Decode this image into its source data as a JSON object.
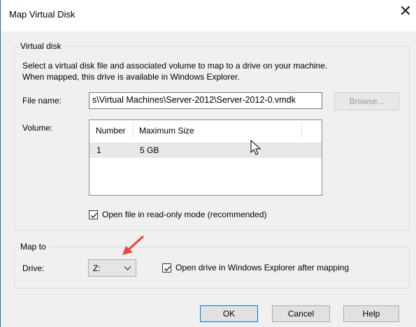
{
  "window": {
    "title": "Map Virtual Disk",
    "close_glyph": "✕"
  },
  "virtual_disk": {
    "legend": "Virtual disk",
    "description_line1": "Select a virtual disk file and associated volume to map to a drive on your machine.",
    "description_line2": "When mapped, this drive is available in Windows Explorer.",
    "file_name_label": "File name:",
    "file_name_value": "s\\Virtual Machines\\Server-2012\\Server-2012-0.vmdk",
    "browse_label": "Browse...",
    "volume_label": "Volume:",
    "volume_columns": [
      "Number",
      "Maximum Size"
    ],
    "volume_rows": [
      {
        "number": "1",
        "size": "5 GB"
      }
    ],
    "readonly_label": "Open file in read-only mode (recommended)",
    "readonly_checked": true
  },
  "map_to": {
    "legend": "Map to",
    "drive_label": "Drive:",
    "drive_value": "Z:",
    "open_explorer_label": "Open drive in Windows Explorer after mapping",
    "open_explorer_checked": true
  },
  "buttons": {
    "ok": "OK",
    "cancel": "Cancel",
    "help": "Help"
  },
  "colors": {
    "window_border": "#1b6ec2",
    "annotation_arrow": "#e8453c",
    "default_button_border": "#0078d7"
  },
  "icons": {
    "cursor": "mouse-cursor-icon",
    "arrow": "red-annotation-arrow-icon",
    "check": "checkmark-icon",
    "chevron": "chevron-down-icon",
    "close": "close-icon"
  }
}
